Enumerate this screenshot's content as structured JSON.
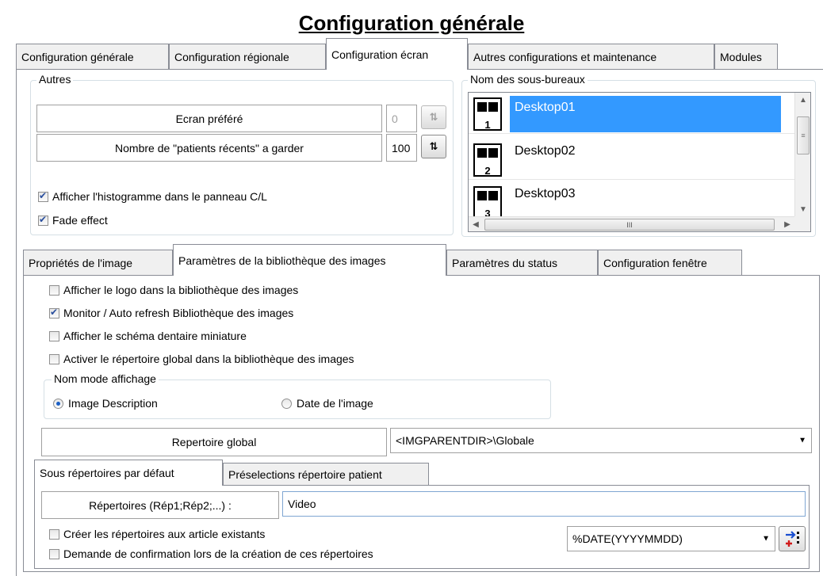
{
  "title": "Configuration générale",
  "main_tabs": [
    {
      "label": "Configuration générale"
    },
    {
      "label": "Configuration régionale"
    },
    {
      "label": "Configuration écran"
    },
    {
      "label": "Autres configurations et maintenance"
    },
    {
      "label": "Modules"
    }
  ],
  "autres": {
    "legend": "Autres",
    "ecran_prefere": {
      "label": "Ecran préféré",
      "value": "0"
    },
    "patients_recents": {
      "label": "Nombre de \"patients récents\" a garder",
      "value": "100"
    },
    "histogramme": {
      "label": "Afficher l'histogramme dans le panneau C/L",
      "checked": true
    },
    "fade": {
      "label": "Fade effect",
      "checked": true
    }
  },
  "sous_bureaux": {
    "legend": "Nom des sous-bureaux",
    "items": [
      {
        "label": "Desktop01",
        "number": "1",
        "selected": true
      },
      {
        "label": "Desktop02",
        "number": "2",
        "selected": false
      },
      {
        "label": "Desktop03",
        "number": "3",
        "selected": false
      }
    ],
    "scroll_thumb_glyph": "III"
  },
  "sub_tabs": [
    {
      "label": "Propriétés de l'image"
    },
    {
      "label": "Paramètres de la bibliothèque des images"
    },
    {
      "label": "Paramètres du status"
    },
    {
      "label": "Configuration fenêtre"
    }
  ],
  "bibliotheque": {
    "options": [
      {
        "label": "Afficher le logo dans la bibliothèque des images",
        "checked": false
      },
      {
        "label": "Monitor / Auto refresh Bibliothèque des images",
        "checked": true
      },
      {
        "label": "Afficher le schéma dentaire miniature",
        "checked": false
      },
      {
        "label": "Activer le répertoire global dans la bibliothèque des images",
        "checked": false
      }
    ],
    "nom_mode": {
      "legend": "Nom mode affichage",
      "options": [
        {
          "label": "Image Description",
          "checked": true
        },
        {
          "label": "Date de l'image",
          "checked": false
        }
      ]
    },
    "repertoire_global": {
      "label": "Repertoire global",
      "value": "<IMGPARENTDIR>\\Globale"
    }
  },
  "inner_tabs": [
    {
      "label": "Sous répertoires par défaut"
    },
    {
      "label": "Préselections répertoire patient"
    }
  ],
  "sous_rep": {
    "repertoires_label": "Répertoires (Rép1;Rép2;...) :",
    "repertoires_value": "Video",
    "creer": {
      "label": "Créer les répertoires aux article existants",
      "checked": false
    },
    "confirmation": {
      "label": "Demande de confirmation lors de la création de ces répertoires",
      "checked": false
    },
    "date_format": "%DATE(YYYYMMDD)"
  }
}
